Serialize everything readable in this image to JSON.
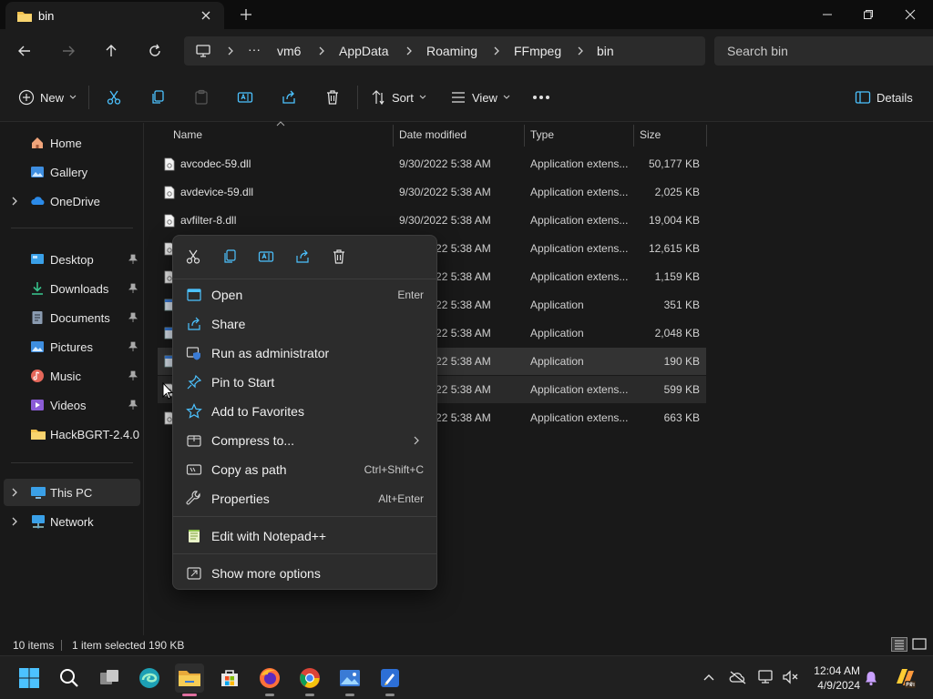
{
  "window": {
    "tab_title": "bin",
    "search_placeholder": "Search bin"
  },
  "breadcrumb": {
    "ellipsis": "···",
    "items": [
      "vm6",
      "AppData",
      "Roaming",
      "FFmpeg",
      "bin"
    ]
  },
  "commandbar": {
    "new": "New",
    "sort": "Sort",
    "view": "View",
    "details": "Details"
  },
  "sidebar": {
    "items": [
      {
        "label": "Home"
      },
      {
        "label": "Gallery"
      },
      {
        "label": "OneDrive"
      },
      {
        "label": "Desktop"
      },
      {
        "label": "Downloads"
      },
      {
        "label": "Documents"
      },
      {
        "label": "Pictures"
      },
      {
        "label": "Music"
      },
      {
        "label": "Videos"
      },
      {
        "label": "HackBGRT-2.4.0"
      },
      {
        "label": "This PC"
      },
      {
        "label": "Network"
      }
    ]
  },
  "filelist": {
    "columns": {
      "name": "Name",
      "date": "Date modified",
      "type": "Type",
      "size": "Size"
    },
    "rows": [
      {
        "name": "avcodec-59.dll",
        "date": "9/30/2022 5:38 AM",
        "type": "Application extens...",
        "size": "50,177 KB"
      },
      {
        "name": "avdevice-59.dll",
        "date": "9/30/2022 5:38 AM",
        "type": "Application extens...",
        "size": "2,025 KB"
      },
      {
        "name": "avfilter-8.dll",
        "date": "9/30/2022 5:38 AM",
        "type": "Application extens...",
        "size": "19,004 KB"
      },
      {
        "name": "",
        "date": "9/30/2022 5:38 AM",
        "type": "Application extens...",
        "size": "12,615 KB"
      },
      {
        "name": "",
        "date": "9/30/2022 5:38 AM",
        "type": "Application extens...",
        "size": "1,159 KB"
      },
      {
        "name": "",
        "date": "9/30/2022 5:38 AM",
        "type": "Application",
        "size": "351 KB"
      },
      {
        "name": "",
        "date": "9/30/2022 5:38 AM",
        "type": "Application",
        "size": "2,048 KB"
      },
      {
        "name": "",
        "date": "9/30/2022 5:38 AM",
        "type": "Application",
        "size": "190 KB"
      },
      {
        "name": "",
        "date": "9/30/2022 5:38 AM",
        "type": "Application extens...",
        "size": "599 KB"
      },
      {
        "name": "",
        "date": "9/30/2022 5:38 AM",
        "type": "Application extens...",
        "size": "663 KB"
      }
    ]
  },
  "context_menu": {
    "items": {
      "open": {
        "label": "Open",
        "key": "Enter"
      },
      "share": {
        "label": "Share"
      },
      "run_admin": {
        "label": "Run as administrator"
      },
      "pin_start": {
        "label": "Pin to Start"
      },
      "favorites": {
        "label": "Add to Favorites"
      },
      "compress": {
        "label": "Compress to..."
      },
      "copy_path": {
        "label": "Copy as path",
        "key": "Ctrl+Shift+C"
      },
      "properties": {
        "label": "Properties",
        "key": "Alt+Enter"
      },
      "notepad": {
        "label": "Edit with Notepad++"
      },
      "more": {
        "label": "Show more options"
      }
    }
  },
  "statusbar": {
    "count": "10 items",
    "selection": "1 item selected",
    "size": "190 KB"
  },
  "taskbar": {
    "time": "12:04 AM",
    "date": "4/9/2024"
  },
  "colors": {
    "accent": "#4cc2ff",
    "folder": "#f2c14e",
    "background": "#191919"
  }
}
